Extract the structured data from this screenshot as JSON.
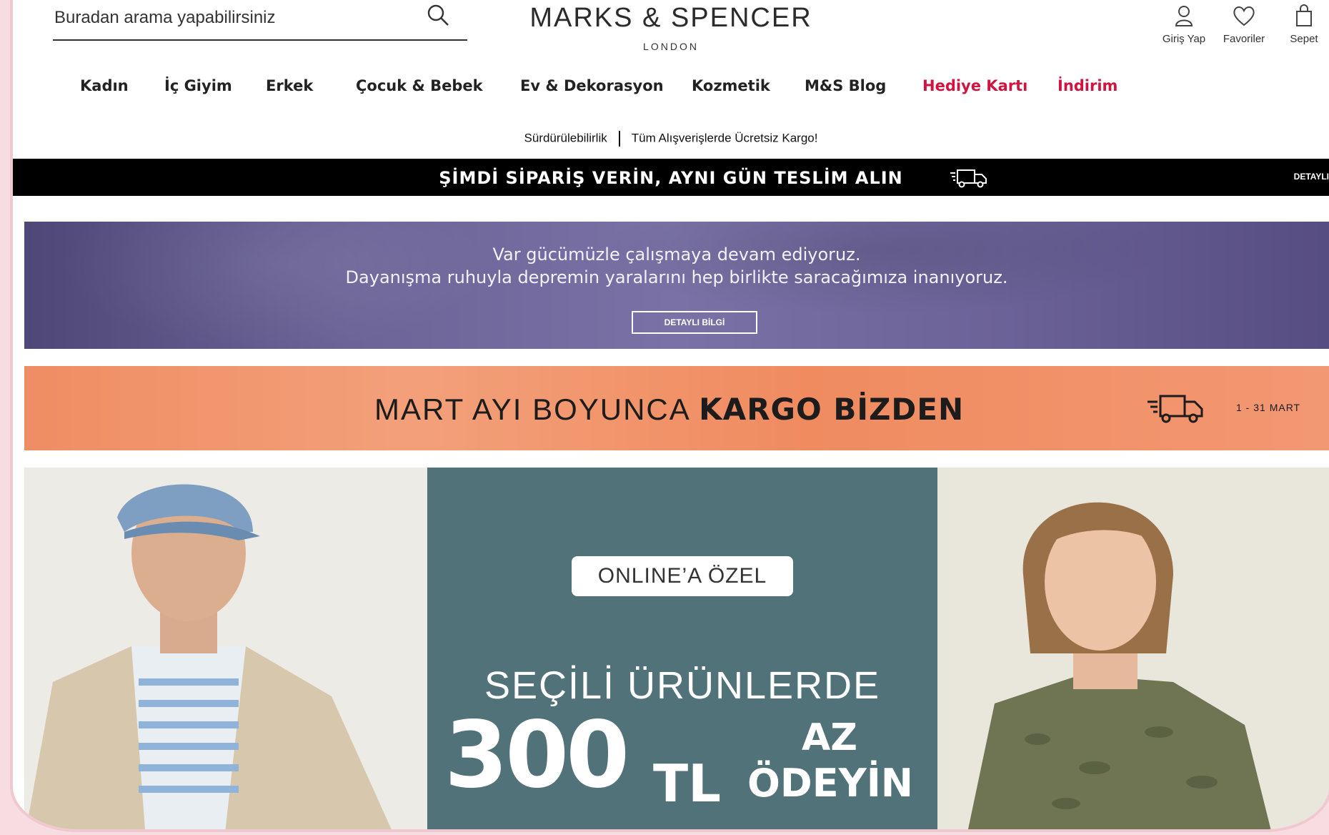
{
  "search": {
    "placeholder": "Buradan arama yapabilirsiniz",
    "value": ""
  },
  "brand": {
    "name": "MARKS & SPENCER",
    "sub": "LONDON"
  },
  "top_actions": [
    {
      "label": "Giriş Yap",
      "icon": "user-icon"
    },
    {
      "label": "Favoriler",
      "icon": "heart-icon"
    },
    {
      "label": "Sepet",
      "icon": "bag-icon"
    }
  ],
  "nav": [
    {
      "label": "Kadın"
    },
    {
      "label": "İç Giyim"
    },
    {
      "label": "Erkek"
    },
    {
      "label": "Çocuk & Bebek"
    },
    {
      "label": "Ev & Dekorasyon"
    },
    {
      "label": "Kozmetik"
    },
    {
      "label": "M&S Blog"
    },
    {
      "label": "Hediye Kartı"
    },
    {
      "label": "İndirim"
    }
  ],
  "sublinks": {
    "left": "Sürdürülebilirlik",
    "right": "Tüm Alışverişlerde Ücretsiz Kargo!"
  },
  "black_bar": {
    "message": "ŞİMDİ SİPARİŞ VERİN, AYNI GÜN TESLİM ALIN",
    "details": "DETAYLI"
  },
  "purple_banner": {
    "line1": "Var gücümüzle çalışmaya devam ediyoruz.",
    "line2": "Dayanışma ruhuyla depremin yaralarını hep birlikte saracağımıza inanıyoruz.",
    "button": "DETAYLI BİLGİ"
  },
  "orange_banner": {
    "text_light": "MART AYI BOYUNCA",
    "text_bold": "KARGO BİZDEN",
    "range": "1 - 31 MART"
  },
  "hero": {
    "badge": "ONLINE’A ÖZEL",
    "line1": "SEÇİLİ ÜRÜNLERDE",
    "amount": "300",
    "currency": "TL",
    "az": "AZ",
    "odeyin": "ÖDEYİN"
  },
  "colors": {
    "accent_red": "#d0143f",
    "purple": "#6c6497",
    "orange": "#f08b60",
    "teal": "#52727a"
  }
}
